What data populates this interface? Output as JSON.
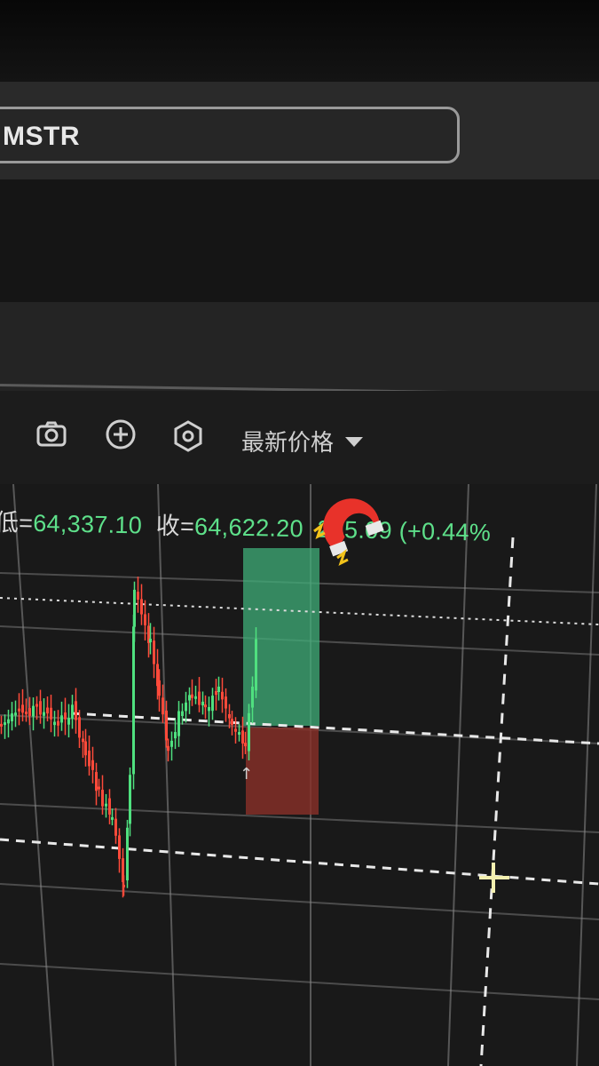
{
  "search": {
    "value": "MSTR"
  },
  "toolbar": {
    "camera_icon": "camera-icon",
    "add_icon": "plus-circle-icon",
    "hex_icon": "hexagon-settings-icon",
    "price_mode_label": "最新价格"
  },
  "ohlc": {
    "low_label": "低=",
    "low_value": "64,337.10",
    "close_label": "收=",
    "close_value": "64,622.20",
    "change_value": "285.09",
    "change_pct": "(+0.44%"
  },
  "colors": {
    "up": "#4fe07f",
    "down": "#ff4a3a",
    "profit_zone": "#3fae78",
    "loss_zone": "#8a2f28",
    "grid": "#8a8a8a"
  },
  "chart_data": {
    "type": "candlestick",
    "title": "",
    "last_close": 64622.2,
    "low": 64337.1,
    "change": 285.09,
    "change_pct": 0.44
  }
}
